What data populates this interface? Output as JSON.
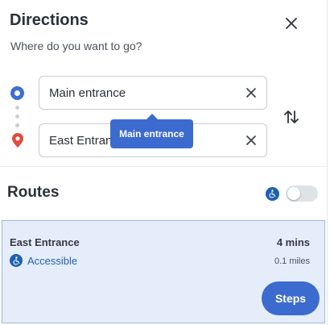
{
  "header": {
    "title": "Directions",
    "subtitle": "Where do you want to go?"
  },
  "form": {
    "origin_value": "Main entrance",
    "destination_value": "East Entrance",
    "tooltip_text": "Main entrance"
  },
  "routes": {
    "title": "Routes",
    "accessible_toggle_on": false,
    "items": [
      {
        "name": "East Entrance",
        "time": "4 mins",
        "accessibility_label": "Accessible",
        "distance": "0.1 miles",
        "steps_label": "Steps"
      }
    ]
  },
  "colors": {
    "accent": "#3c6bd0",
    "accessible_blue": "#1d5fb3",
    "pin_red": "#e04b3c",
    "selected_route_bg": "#e6edfa"
  },
  "icons": [
    "close-icon",
    "origin-marker-icon",
    "location-pin-icon",
    "clear-icon",
    "swap-icon",
    "wheelchair-icon"
  ]
}
